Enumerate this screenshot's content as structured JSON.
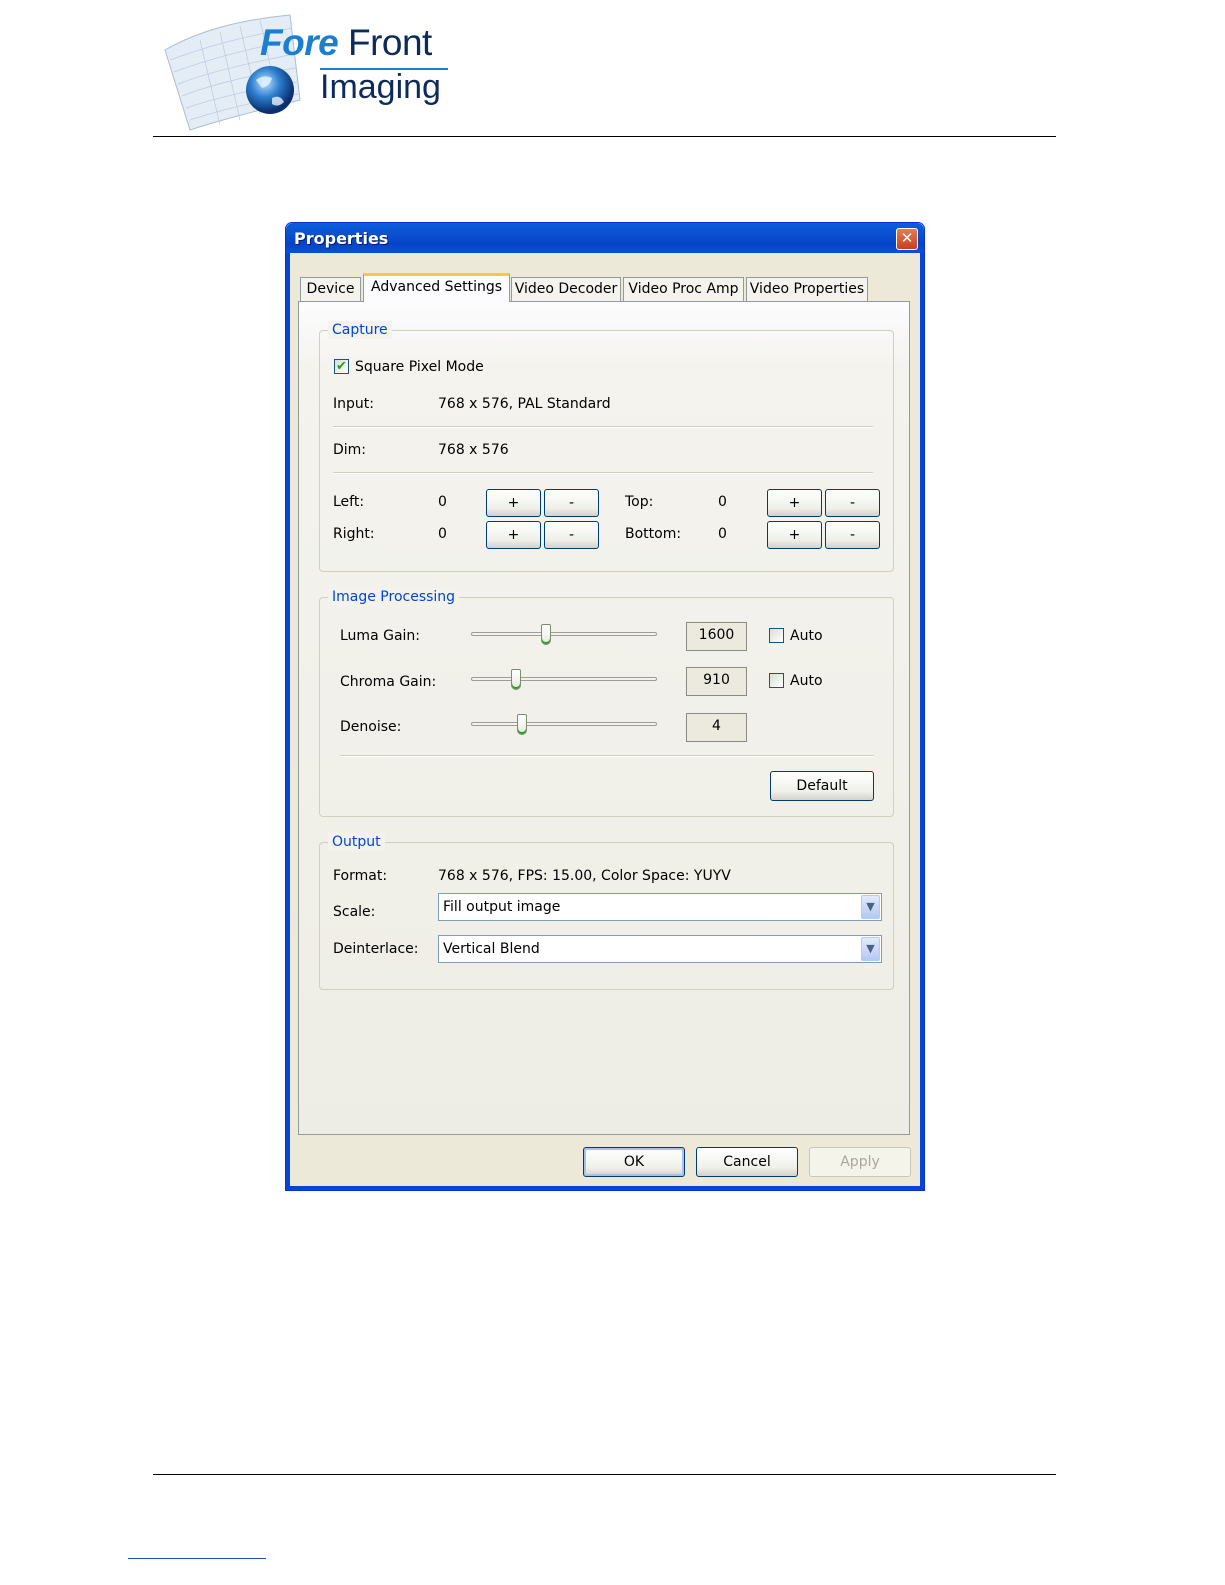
{
  "logo": {
    "word_fore": "Fore",
    "word_front": "Front",
    "word_imaging": "Imaging"
  },
  "window": {
    "title": "Properties",
    "close_glyph": "✕"
  },
  "tabs": [
    {
      "label": "Device"
    },
    {
      "label": "Advanced Settings",
      "active": true
    },
    {
      "label": "Video Decoder"
    },
    {
      "label": "Video Proc Amp"
    },
    {
      "label": "Video Properties"
    }
  ],
  "capture": {
    "title": "Capture",
    "square_pixel_mode": {
      "label": "Square Pixel Mode",
      "checked": true
    },
    "input_label": "Input:",
    "input_value": "768 x 576, PAL Standard",
    "dim_label": "Dim:",
    "dim_value": "768 x 576",
    "left_label": "Left:",
    "left_value": "0",
    "right_label": "Right:",
    "right_value": "0",
    "top_label": "Top:",
    "top_value": "0",
    "bottom_label": "Bottom:",
    "bottom_value": "0",
    "plus": "+",
    "minus": "-"
  },
  "image_processing": {
    "title": "Image Processing",
    "luma": {
      "label": "Luma Gain:",
      "value": "1600",
      "auto_label": "Auto",
      "auto": false,
      "slider_fraction": 0.4
    },
    "chroma": {
      "label": "Chroma Gain:",
      "value": "910",
      "auto_label": "Auto",
      "auto": false,
      "slider_fraction": 0.23
    },
    "denoise": {
      "label": "Denoise:",
      "value": "4",
      "slider_fraction": 0.26
    },
    "default_button": "Default"
  },
  "output": {
    "title": "Output",
    "format_label": "Format:",
    "format_value": "768 x 576, FPS: 15.00, Color Space: YUYV",
    "scale_label": "Scale:",
    "scale_value": "Fill output image",
    "deinterlace_label": "Deinterlace:",
    "deinterlace_value": "Vertical Blend"
  },
  "footer_buttons": {
    "ok": "OK",
    "cancel": "Cancel",
    "apply": "Apply"
  },
  "colors": {
    "titlebar": "#0a5fdc",
    "group_label": "#0046d5",
    "logo_blue": "#1a7fd0"
  }
}
